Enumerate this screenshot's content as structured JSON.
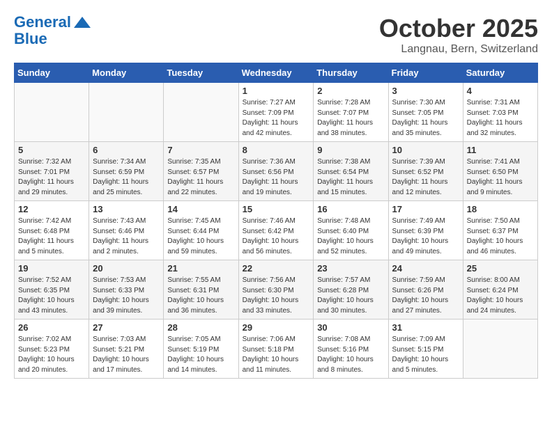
{
  "header": {
    "logo_line1": "General",
    "logo_line2": "Blue",
    "month": "October 2025",
    "location": "Langnau, Bern, Switzerland"
  },
  "weekdays": [
    "Sunday",
    "Monday",
    "Tuesday",
    "Wednesday",
    "Thursday",
    "Friday",
    "Saturday"
  ],
  "weeks": [
    [
      {
        "day": "",
        "info": ""
      },
      {
        "day": "",
        "info": ""
      },
      {
        "day": "",
        "info": ""
      },
      {
        "day": "1",
        "info": "Sunrise: 7:27 AM\nSunset: 7:09 PM\nDaylight: 11 hours and 42 minutes."
      },
      {
        "day": "2",
        "info": "Sunrise: 7:28 AM\nSunset: 7:07 PM\nDaylight: 11 hours and 38 minutes."
      },
      {
        "day": "3",
        "info": "Sunrise: 7:30 AM\nSunset: 7:05 PM\nDaylight: 11 hours and 35 minutes."
      },
      {
        "day": "4",
        "info": "Sunrise: 7:31 AM\nSunset: 7:03 PM\nDaylight: 11 hours and 32 minutes."
      }
    ],
    [
      {
        "day": "5",
        "info": "Sunrise: 7:32 AM\nSunset: 7:01 PM\nDaylight: 11 hours and 29 minutes."
      },
      {
        "day": "6",
        "info": "Sunrise: 7:34 AM\nSunset: 6:59 PM\nDaylight: 11 hours and 25 minutes."
      },
      {
        "day": "7",
        "info": "Sunrise: 7:35 AM\nSunset: 6:57 PM\nDaylight: 11 hours and 22 minutes."
      },
      {
        "day": "8",
        "info": "Sunrise: 7:36 AM\nSunset: 6:56 PM\nDaylight: 11 hours and 19 minutes."
      },
      {
        "day": "9",
        "info": "Sunrise: 7:38 AM\nSunset: 6:54 PM\nDaylight: 11 hours and 15 minutes."
      },
      {
        "day": "10",
        "info": "Sunrise: 7:39 AM\nSunset: 6:52 PM\nDaylight: 11 hours and 12 minutes."
      },
      {
        "day": "11",
        "info": "Sunrise: 7:41 AM\nSunset: 6:50 PM\nDaylight: 11 hours and 9 minutes."
      }
    ],
    [
      {
        "day": "12",
        "info": "Sunrise: 7:42 AM\nSunset: 6:48 PM\nDaylight: 11 hours and 5 minutes."
      },
      {
        "day": "13",
        "info": "Sunrise: 7:43 AM\nSunset: 6:46 PM\nDaylight: 11 hours and 2 minutes."
      },
      {
        "day": "14",
        "info": "Sunrise: 7:45 AM\nSunset: 6:44 PM\nDaylight: 10 hours and 59 minutes."
      },
      {
        "day": "15",
        "info": "Sunrise: 7:46 AM\nSunset: 6:42 PM\nDaylight: 10 hours and 56 minutes."
      },
      {
        "day": "16",
        "info": "Sunrise: 7:48 AM\nSunset: 6:40 PM\nDaylight: 10 hours and 52 minutes."
      },
      {
        "day": "17",
        "info": "Sunrise: 7:49 AM\nSunset: 6:39 PM\nDaylight: 10 hours and 49 minutes."
      },
      {
        "day": "18",
        "info": "Sunrise: 7:50 AM\nSunset: 6:37 PM\nDaylight: 10 hours and 46 minutes."
      }
    ],
    [
      {
        "day": "19",
        "info": "Sunrise: 7:52 AM\nSunset: 6:35 PM\nDaylight: 10 hours and 43 minutes."
      },
      {
        "day": "20",
        "info": "Sunrise: 7:53 AM\nSunset: 6:33 PM\nDaylight: 10 hours and 39 minutes."
      },
      {
        "day": "21",
        "info": "Sunrise: 7:55 AM\nSunset: 6:31 PM\nDaylight: 10 hours and 36 minutes."
      },
      {
        "day": "22",
        "info": "Sunrise: 7:56 AM\nSunset: 6:30 PM\nDaylight: 10 hours and 33 minutes."
      },
      {
        "day": "23",
        "info": "Sunrise: 7:57 AM\nSunset: 6:28 PM\nDaylight: 10 hours and 30 minutes."
      },
      {
        "day": "24",
        "info": "Sunrise: 7:59 AM\nSunset: 6:26 PM\nDaylight: 10 hours and 27 minutes."
      },
      {
        "day": "25",
        "info": "Sunrise: 8:00 AM\nSunset: 6:24 PM\nDaylight: 10 hours and 24 minutes."
      }
    ],
    [
      {
        "day": "26",
        "info": "Sunrise: 7:02 AM\nSunset: 5:23 PM\nDaylight: 10 hours and 20 minutes."
      },
      {
        "day": "27",
        "info": "Sunrise: 7:03 AM\nSunset: 5:21 PM\nDaylight: 10 hours and 17 minutes."
      },
      {
        "day": "28",
        "info": "Sunrise: 7:05 AM\nSunset: 5:19 PM\nDaylight: 10 hours and 14 minutes."
      },
      {
        "day": "29",
        "info": "Sunrise: 7:06 AM\nSunset: 5:18 PM\nDaylight: 10 hours and 11 minutes."
      },
      {
        "day": "30",
        "info": "Sunrise: 7:08 AM\nSunset: 5:16 PM\nDaylight: 10 hours and 8 minutes."
      },
      {
        "day": "31",
        "info": "Sunrise: 7:09 AM\nSunset: 5:15 PM\nDaylight: 10 hours and 5 minutes."
      },
      {
        "day": "",
        "info": ""
      }
    ]
  ]
}
